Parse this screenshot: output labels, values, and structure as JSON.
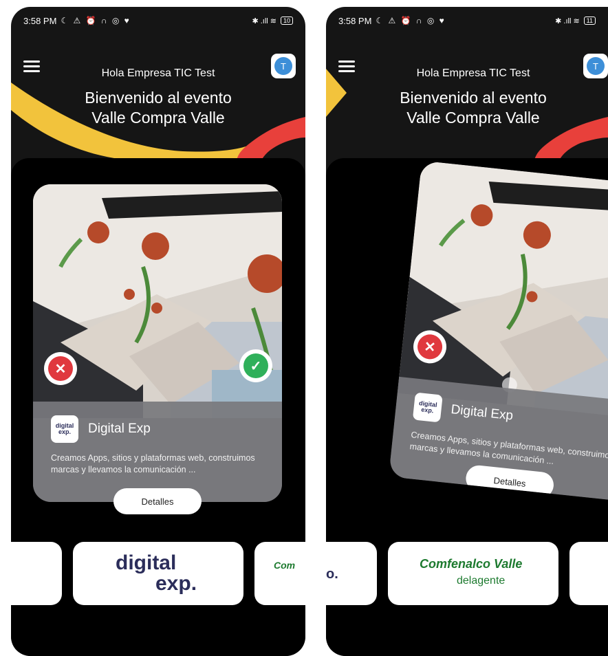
{
  "status_bar": {
    "time": "3:58 PM",
    "left_icons": "☾ ⚠ ⏰ ∩ ◎ ♥",
    "right_icons": "✱ .ıll ≋",
    "battery_left": "10",
    "battery_right": "11"
  },
  "header": {
    "greeting": "Hola Empresa TIC Test",
    "welcome_line1": "Bienvenido al evento",
    "welcome_line2": "Valle Compra Valle",
    "avatar_initial": "T"
  },
  "card": {
    "company_name": "Digital Exp",
    "mini_logo_line1": "digital",
    "mini_logo_line2": "exp.",
    "description": "Creamos Apps, sitios y plataformas web, construimos marcas y llevamos la comunicación ...",
    "details_label": "Detalles"
  },
  "logos": {
    "digital_line1": "digital",
    "digital_line2": "exp.",
    "comfenalco_title": "Comfenalco Valle",
    "comfenalco_sub": "delagente",
    "partial_left": "Com",
    "partial_right": "o."
  },
  "colors": {
    "accent_yellow": "#f2c33c",
    "accent_red": "#e8403b",
    "reject": "#e0383e",
    "accept": "#2fb05a",
    "avatar": "#3d8fd8"
  }
}
